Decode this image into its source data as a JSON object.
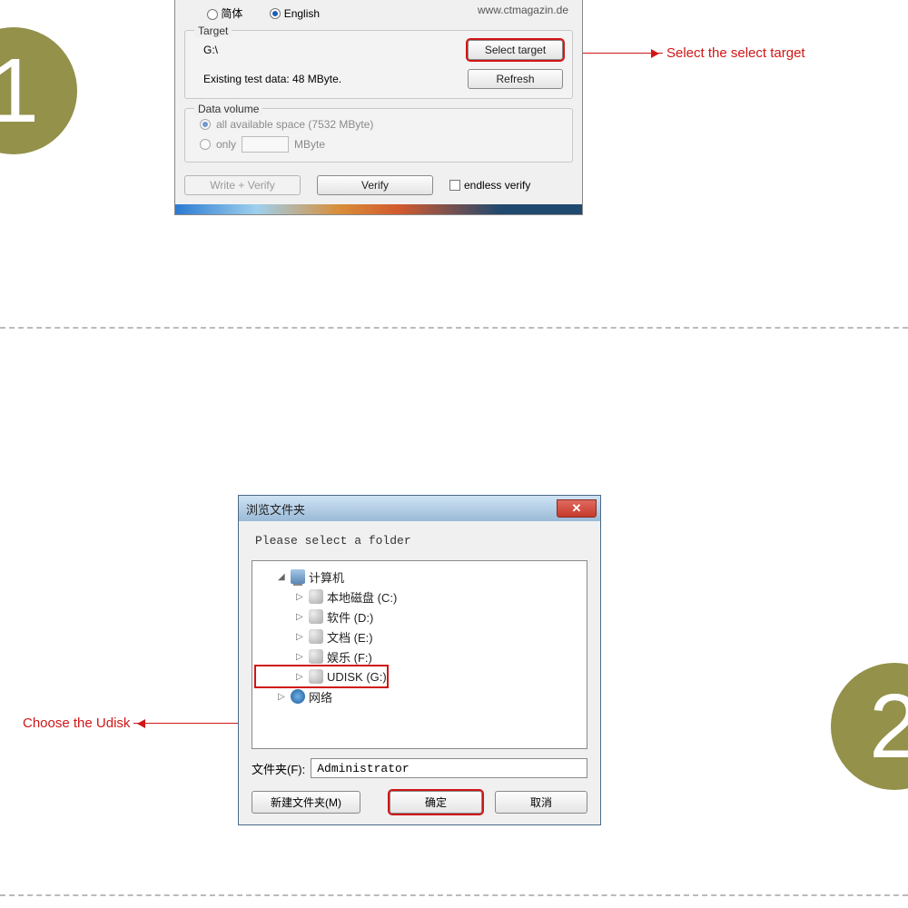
{
  "step1": {
    "number": "1"
  },
  "step2": {
    "number": "2"
  },
  "anno1": {
    "text": "Select the select target"
  },
  "anno2": {
    "text": "Choose the Udisk"
  },
  "win1": {
    "lang": {
      "simplified": "简体",
      "english": "English"
    },
    "url": "www.ctmagazin.de",
    "target": {
      "legend": "Target",
      "path": "G:\\",
      "select_btn": "Select target",
      "existing": "Existing test data: 48 MByte.",
      "refresh_btn": "Refresh"
    },
    "datavol": {
      "legend": "Data volume",
      "all": "all available space (7532 MByte)",
      "only": "only",
      "unit": "MByte"
    },
    "actions": {
      "write_verify": "Write + Verify",
      "verify": "Verify",
      "endless": "endless verify"
    }
  },
  "win2": {
    "title": "浏览文件夹",
    "prompt": "Please select a folder",
    "tree": {
      "computer": "计算机",
      "c": "本地磁盘 (C:)",
      "d": "软件 (D:)",
      "e": "文档 (E:)",
      "f": "娱乐 (F:)",
      "g": "UDISK (G:)",
      "network": "网络"
    },
    "folder_label": "文件夹(F):",
    "folder_value": "Administrator",
    "buttons": {
      "new": "新建文件夹(M)",
      "ok": "确定",
      "cancel": "取消"
    }
  }
}
